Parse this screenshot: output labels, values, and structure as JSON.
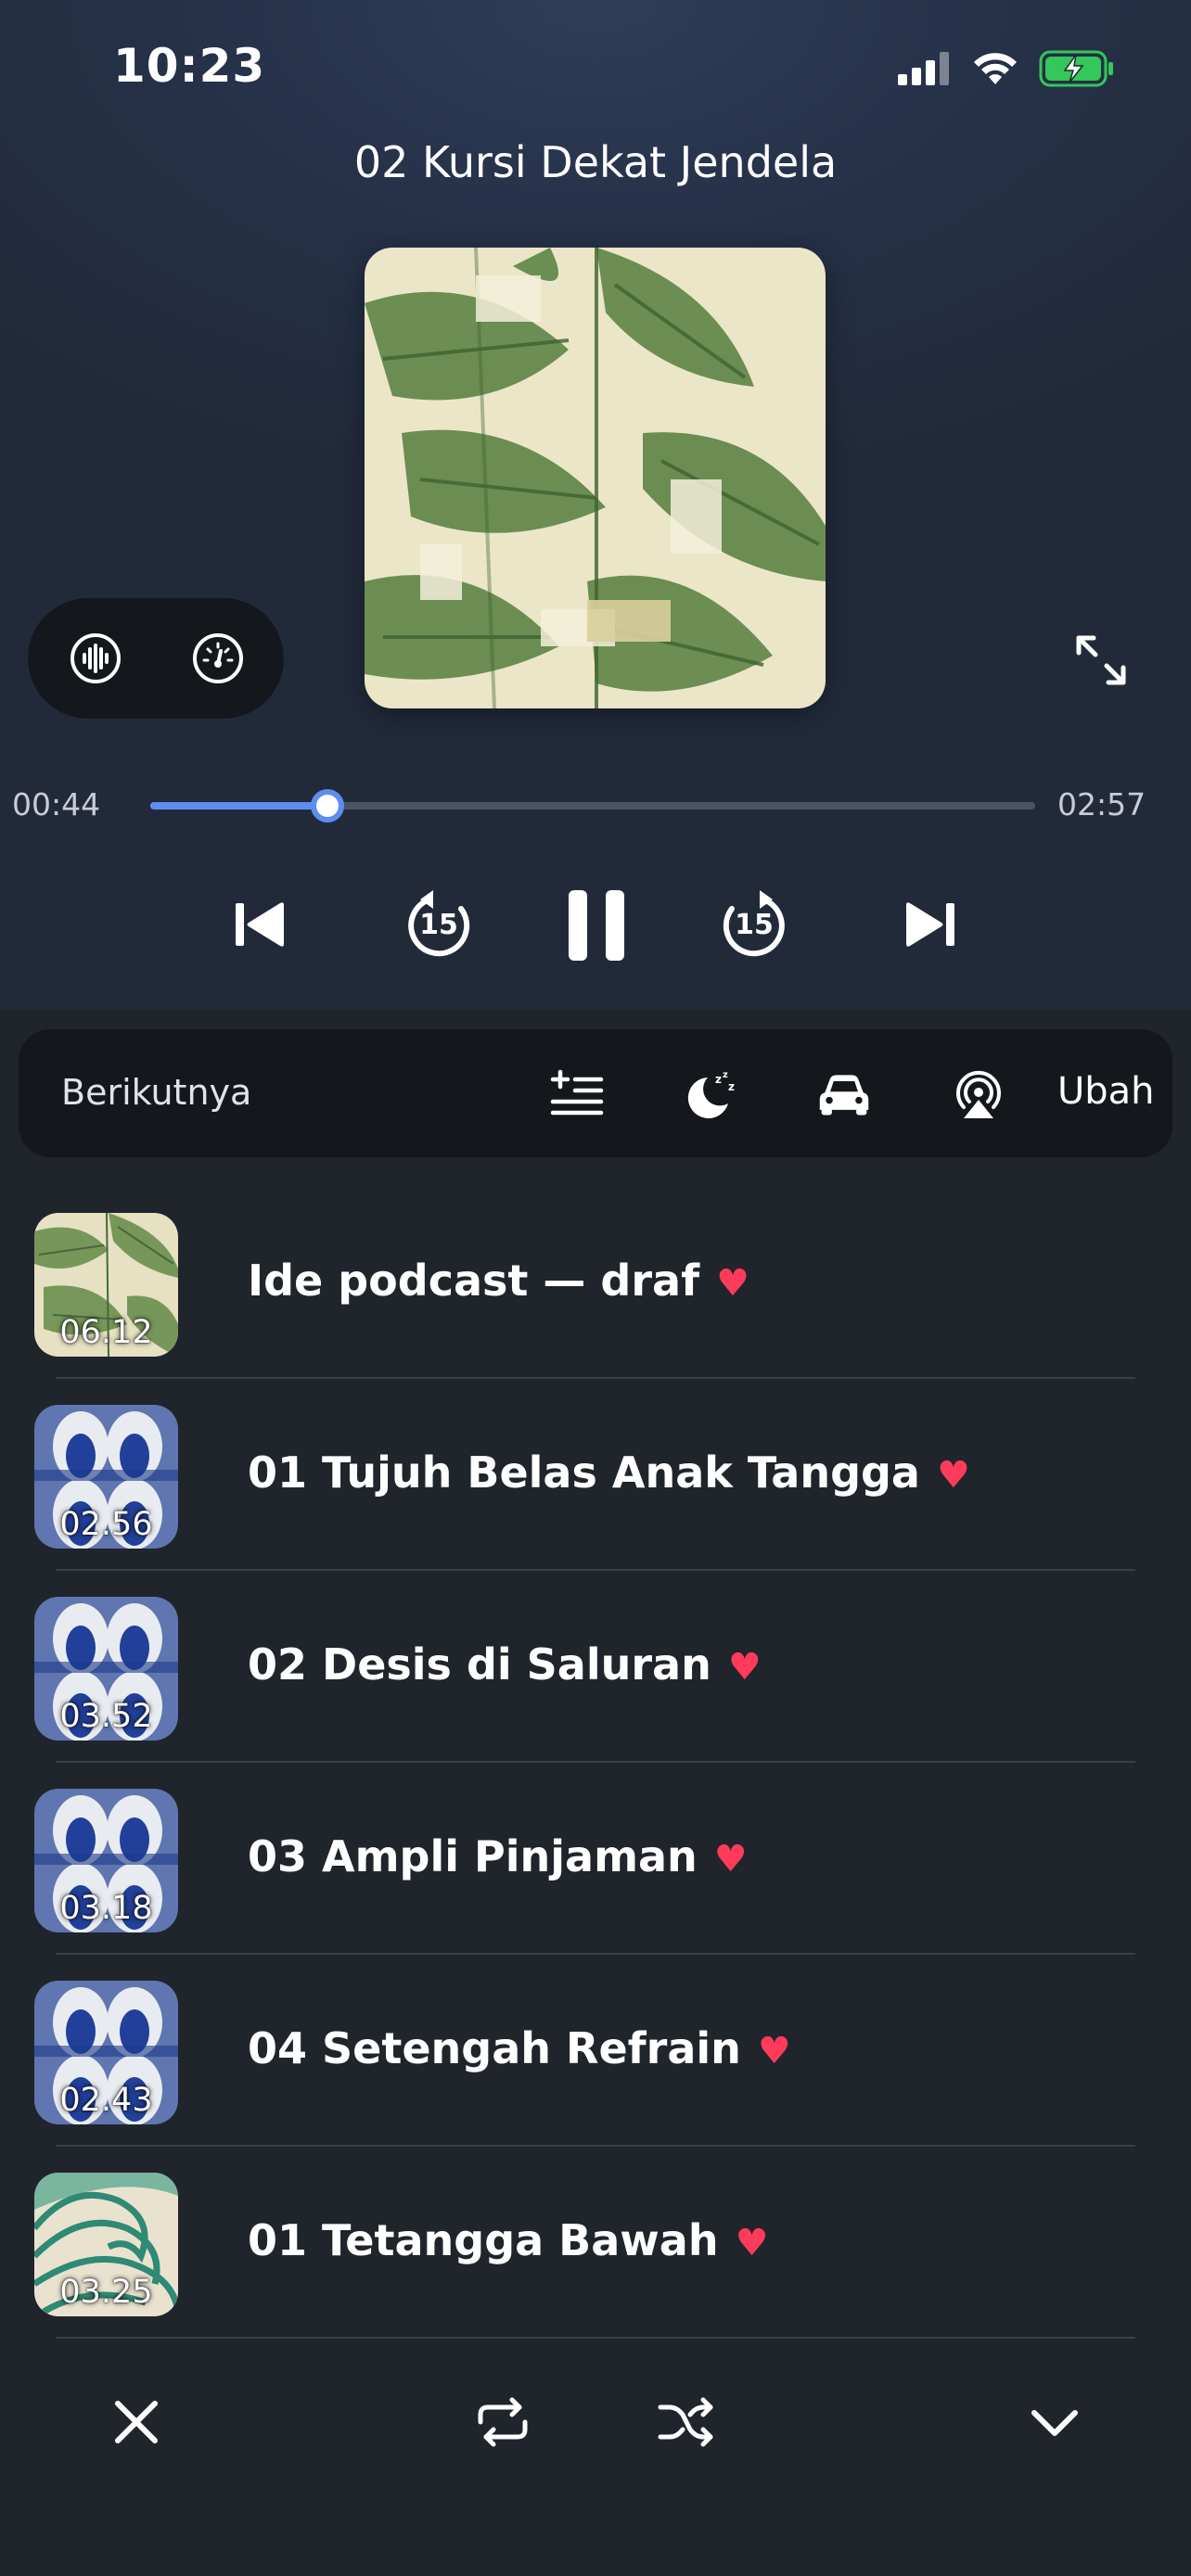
{
  "status": {
    "time": "10:23"
  },
  "now_playing": {
    "title": "02 Kursi Dekat Jendela",
    "elapsed": "00:44",
    "duration": "02:57",
    "progress": 0.2,
    "skip_seconds_back": "15",
    "skip_seconds_forward": "15"
  },
  "next_bar": {
    "label": "Berikutnya",
    "edit_label": "Ubah"
  },
  "queue": [
    {
      "title": "Ide podcast — draf",
      "duration": "06.12",
      "art": "leaf"
    },
    {
      "title": "01 Tujuh Belas Anak Tangga",
      "duration": "02.56",
      "art": "blue"
    },
    {
      "title": "02 Desis di Saluran",
      "duration": "03.52",
      "art": "blue"
    },
    {
      "title": "03 Ampli Pinjaman",
      "duration": "03.18",
      "art": "blue"
    },
    {
      "title": "04 Setengah Refrain",
      "duration": "02.43",
      "art": "blue"
    },
    {
      "title": "01 Tetangga Bawah",
      "duration": "03.25",
      "art": "wave"
    }
  ],
  "heart_glyph": "♥",
  "colors": {
    "accent": "#5d8df0",
    "heart": "#ff3b5c",
    "battery": "#34c759"
  },
  "icons": {
    "pill": [
      "waveform-icon",
      "speed-gauge-icon"
    ],
    "next_bar": [
      "add-to-queue-icon",
      "sleep-timer-icon",
      "car-mode-icon",
      "airplay-icon"
    ],
    "toolbar": [
      "close-icon",
      "repeat-icon",
      "shuffle-icon",
      "chevron-down-icon"
    ]
  }
}
